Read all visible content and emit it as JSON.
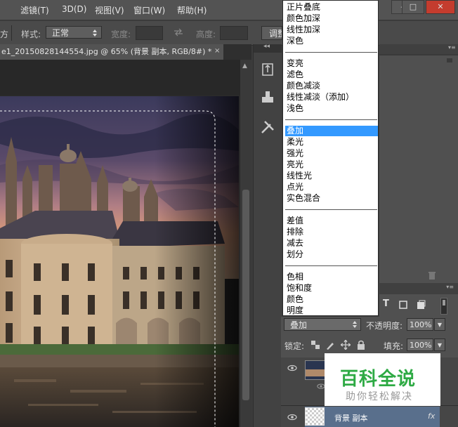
{
  "menubar": {
    "items": [
      {
        "id": "filter",
        "label": "滤镜(T)"
      },
      {
        "id": "3d",
        "label": "3D(D)"
      },
      {
        "id": "view",
        "label": "视图(V)"
      },
      {
        "id": "window",
        "label": "窗口(W)"
      },
      {
        "id": "help",
        "label": "帮助(H)"
      }
    ],
    "window_controls": {
      "minimize": "–",
      "maximize": "□",
      "close": "✕"
    }
  },
  "options_bar": {
    "left_label": "方",
    "style_label": "样式:",
    "style_value": "正常",
    "width_label": "宽度:",
    "height_label": "高度:",
    "adjust_button": "调整"
  },
  "document": {
    "tab_title": "e1_20150828144554.jpg @ 65% (背景 副本, RGB/8#) *",
    "close_glyph": "×"
  },
  "blend_menu": {
    "selected": "叠加",
    "groups": [
      [
        "正片叠底",
        "颜色加深",
        "线性加深",
        "深色"
      ],
      [
        "变亮",
        "滤色",
        "颜色减淡",
        "线性减淡（添加）",
        "浅色"
      ],
      [
        "叠加",
        "柔光",
        "强光",
        "亮光",
        "线性光",
        "点光",
        "实色混合"
      ],
      [
        "差值",
        "排除",
        "减去",
        "划分"
      ],
      [
        "色相",
        "饱和度",
        "颜色",
        "明度"
      ]
    ]
  },
  "layers_panel": {
    "blend_mode": "叠加",
    "opacity_label": "不透明度:",
    "opacity_value": "100%",
    "lock_label": "锁定:",
    "fill_label": "填充:",
    "fill_value": "100%",
    "layer_name": "背景 副本",
    "fx_label": "fx"
  },
  "watermark": {
    "title": "百科全说",
    "subtitle": "助你轻松解决"
  },
  "colors": {
    "menubar": "#535353",
    "panel": "#505050",
    "selection": "#3399ff",
    "watermark_green": "#2eaa44"
  }
}
